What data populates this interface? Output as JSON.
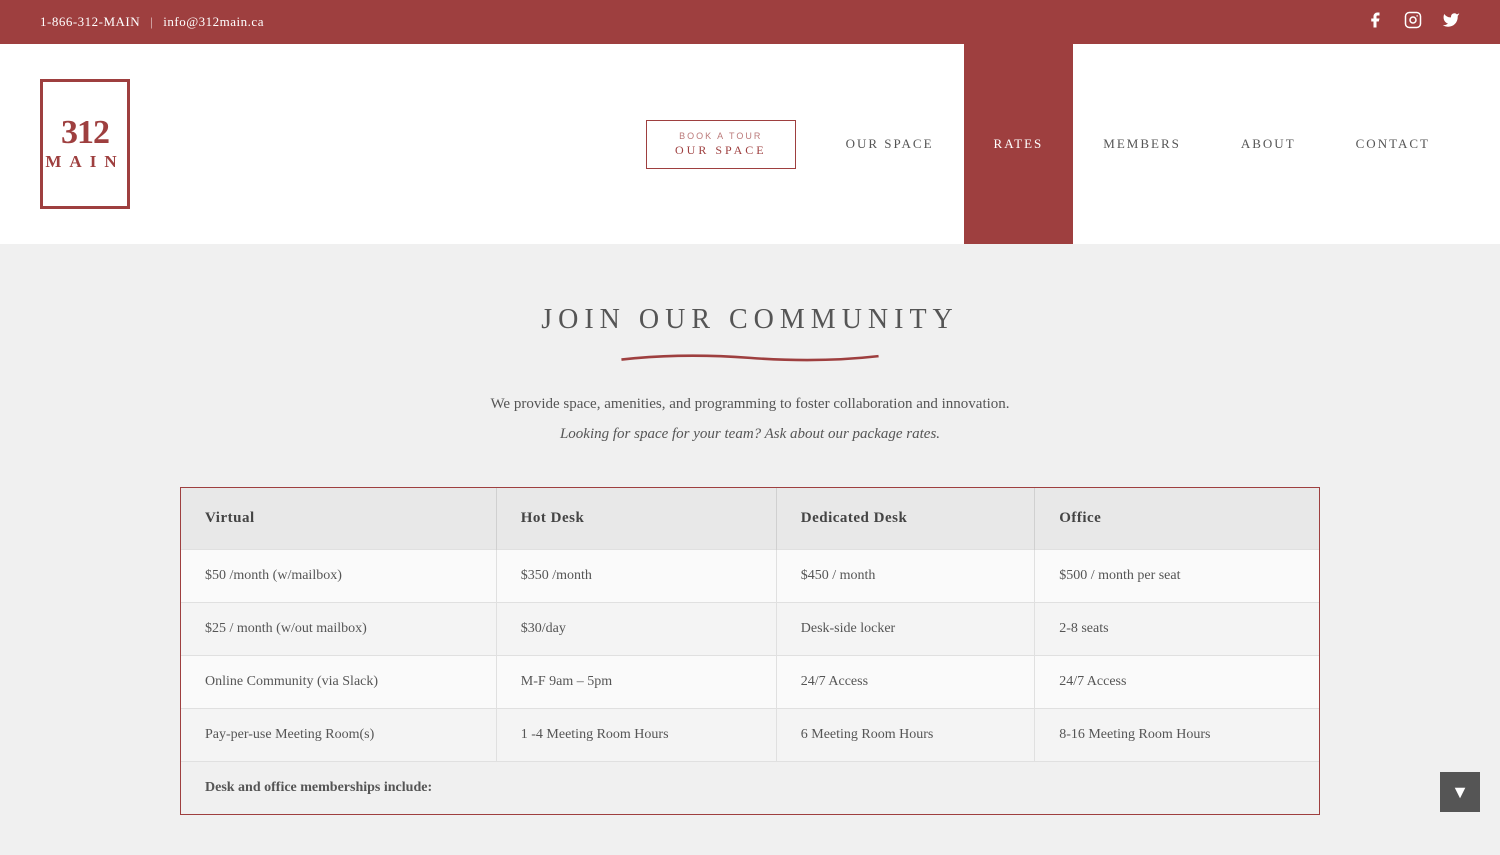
{
  "topbar": {
    "phone": "1-866-312-MAIN",
    "separator": "|",
    "email": "info@312main.ca",
    "social": [
      {
        "name": "facebook",
        "icon": "f",
        "label": "Facebook"
      },
      {
        "name": "instagram",
        "icon": "◻",
        "label": "Instagram"
      },
      {
        "name": "twitter",
        "icon": "t",
        "label": "Twitter"
      }
    ]
  },
  "logo": {
    "number": "312",
    "word": "MAIN"
  },
  "nav": {
    "book_tour_small": "BOOK A TOUR",
    "book_tour_main": "OUR SPACE",
    "items": [
      {
        "label": "OUR SPACE",
        "active": false
      },
      {
        "label": "RATES",
        "active": true
      },
      {
        "label": "MEMBERS",
        "active": false
      },
      {
        "label": "ABOUT",
        "active": false
      },
      {
        "label": "CONTACT",
        "active": false
      }
    ]
  },
  "main": {
    "title": "JOIN OUR COMMUNITY",
    "description": "We provide space, amenities, and programming to foster collaboration and innovation.",
    "italic_desc": "Looking for space for your team? Ask about our package rates.",
    "table": {
      "headers": [
        "Virtual",
        "Hot Desk",
        "Dedicated Desk",
        "Office"
      ],
      "rows": [
        [
          "$50 /month (w/mailbox)",
          "$350 /month",
          "$450 / month",
          "$500 / month per seat"
        ],
        [
          "$25 / month (w/out mailbox)",
          "$30/day",
          "Desk-side locker",
          "2-8 seats"
        ],
        [
          "Online Community  (via Slack)",
          "M-F 9am – 5pm",
          "24/7 Access",
          "24/7 Access"
        ],
        [
          "Pay-per-use Meeting Room(s)",
          "1 -4 Meeting Room Hours",
          "6 Meeting Room Hours",
          "8-16 Meeting Room Hours"
        ]
      ],
      "includes_label": "Desk and office memberships include:"
    }
  },
  "scroll_down": "▼"
}
